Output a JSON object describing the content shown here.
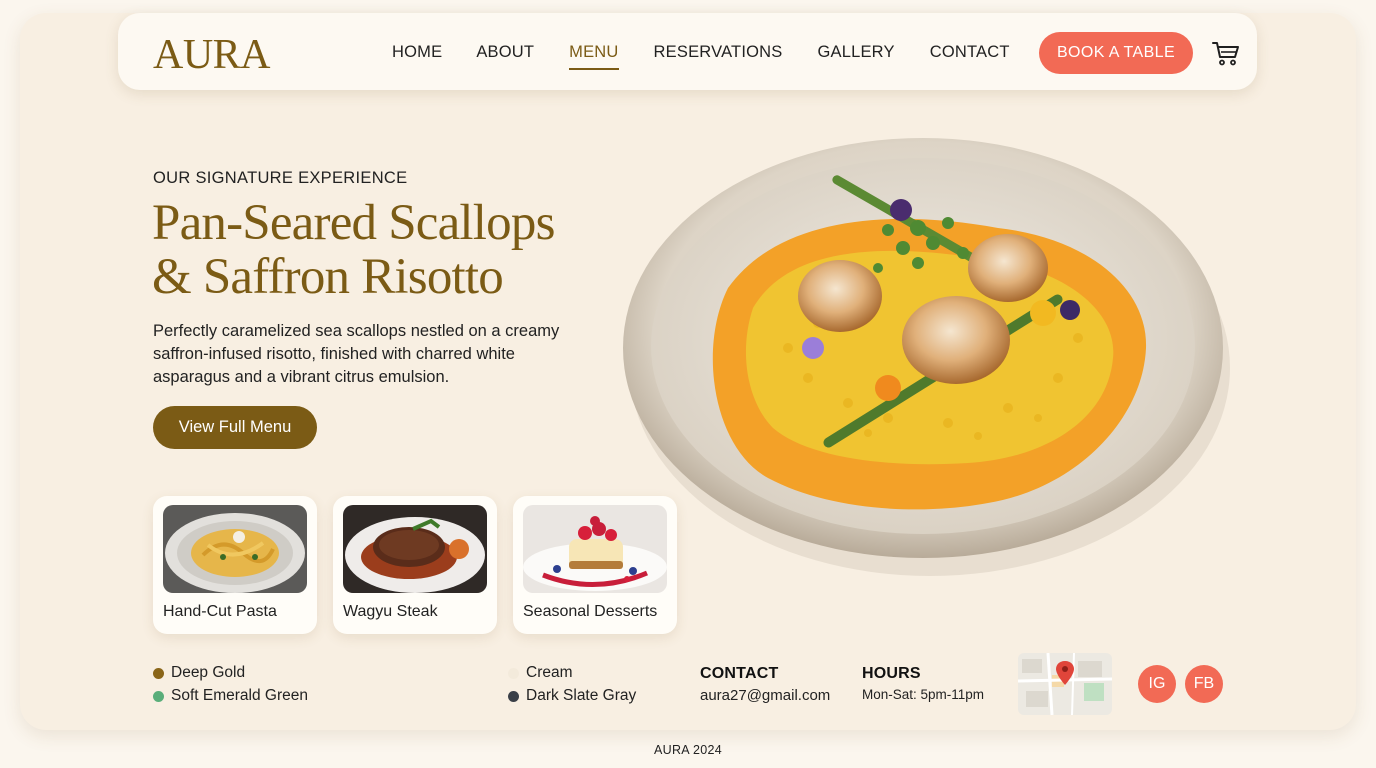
{
  "brand": {
    "logo": "AURA"
  },
  "nav": {
    "links": [
      {
        "label": "HOME",
        "active": false
      },
      {
        "label": "ABOUT",
        "active": false
      },
      {
        "label": "MENU",
        "active": true
      },
      {
        "label": "RESERVATIONS",
        "active": false
      },
      {
        "label": "GALLERY",
        "active": false
      },
      {
        "label": "CONTACT",
        "active": false
      }
    ],
    "cta": "BOOK A TABLE",
    "cart_icon": "shopping-cart-icon"
  },
  "hero": {
    "eyebrow": "OUR SIGNATURE EXPERIENCE",
    "title_line1": "Pan-Seared Scallops",
    "title_line2": "& Saffron Risotto",
    "description": "Perfectly caramelized sea scallops nestled on a creamy saffron-infused risotto, finished with charred white asparagus and a vibrant citrus emulsion.",
    "button": "View Full Menu"
  },
  "dishes": [
    {
      "label": "Hand-Cut Pasta"
    },
    {
      "label": "Wagyu Steak"
    },
    {
      "label": "Seasonal Desserts"
    }
  ],
  "palette": [
    {
      "name": "Deep Gold",
      "color": "#8a6518"
    },
    {
      "name": "Soft Emerald Green",
      "color": "#5aae7a"
    },
    {
      "name": "Cream",
      "color": "#f3eadb"
    },
    {
      "name": "Dark Slate Gray",
      "color": "#3a3f47"
    }
  ],
  "contact": {
    "title": "CONTACT",
    "email": "aura27@gmail.com"
  },
  "hours": {
    "title": "HOURS",
    "value": "Mon-Sat: 5pm-11pm"
  },
  "social": {
    "instagram": "IG",
    "facebook": "FB"
  },
  "footer": {
    "copyright": "AURA 2024"
  },
  "colors": {
    "accent": "#f26a55",
    "brand": "#7b5b15",
    "background": "#f8efe2"
  }
}
